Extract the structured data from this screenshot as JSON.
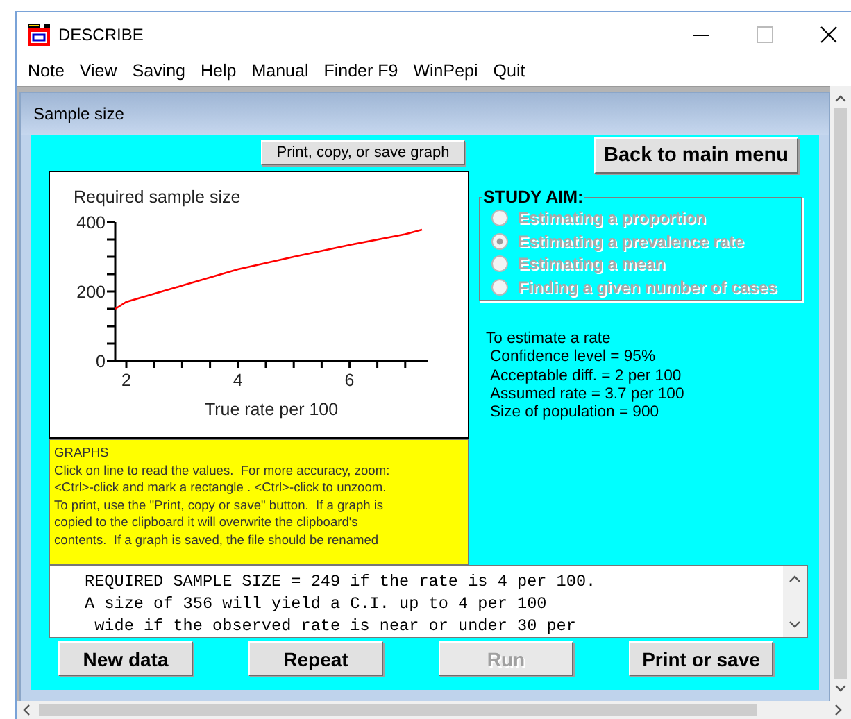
{
  "window": {
    "title": "DESCRIBE"
  },
  "menu": [
    "Note",
    "View",
    "Saving",
    "Help",
    "Manual",
    "Finder F9",
    "WinPepi",
    "Quit"
  ],
  "child_window": {
    "title": "Sample size"
  },
  "graph_button": {
    "label": "Print, copy, or save graph"
  },
  "back_button": {
    "label": "Back to main menu"
  },
  "chart": {
    "chart_data": {
      "type": "line",
      "title": "Required sample size",
      "xlabel": "True rate per 100",
      "x": [
        1.8,
        2,
        3,
        4,
        5,
        6,
        7,
        7.3
      ],
      "values": [
        150,
        170,
        217,
        264,
        300,
        334,
        365,
        378
      ],
      "xlim": [
        1.8,
        7.4
      ],
      "ylim": [
        0,
        400
      ],
      "xticks": [
        2,
        4,
        6
      ],
      "yticks": [
        0,
        200,
        400
      ]
    }
  },
  "note": {
    "heading": "GRAPHS",
    "lines": [
      "Click on line to read the values.  For more accuracy, zoom:",
      "<Ctrl>-click and mark a rectangle . <Ctrl>-click to unzoom.",
      "To print, use the \"Print, copy or save\" button.  If a graph is",
      "copied to the clipboard it will overwrite the clipboard's",
      "contents.  If a graph is saved, the file should be renamed"
    ]
  },
  "study_aim": {
    "title": "STUDY AIM:",
    "options": [
      {
        "label": "Estimating a proportion",
        "selected": false,
        "disabled": true
      },
      {
        "label": "Estimating a prevalence rate",
        "selected": true,
        "disabled": true
      },
      {
        "label": "Estimating a mean",
        "selected": false,
        "disabled": true
      },
      {
        "label": "Finding a given number of cases",
        "selected": false,
        "disabled": true
      }
    ]
  },
  "summary": {
    "heading": "To estimate a rate",
    "lines": [
      "Confidence level = 95%",
      "Acceptable diff. = 2 per 100",
      "Assumed rate = 3.7 per 100",
      "Size of population = 900"
    ]
  },
  "results": {
    "lines": [
      "REQUIRED SAMPLE SIZE = 249 if the rate is 4 per 100.",
      "A size of 356 will yield a C.I. up to 4 per 100",
      " wide if the observed rate is near or under 30 per"
    ]
  },
  "buttons": [
    {
      "label": "New data",
      "disabled": false
    },
    {
      "label": "Repeat",
      "disabled": false
    },
    {
      "label": "Run",
      "disabled": true
    },
    {
      "label": "Print or save",
      "disabled": false
    }
  ]
}
